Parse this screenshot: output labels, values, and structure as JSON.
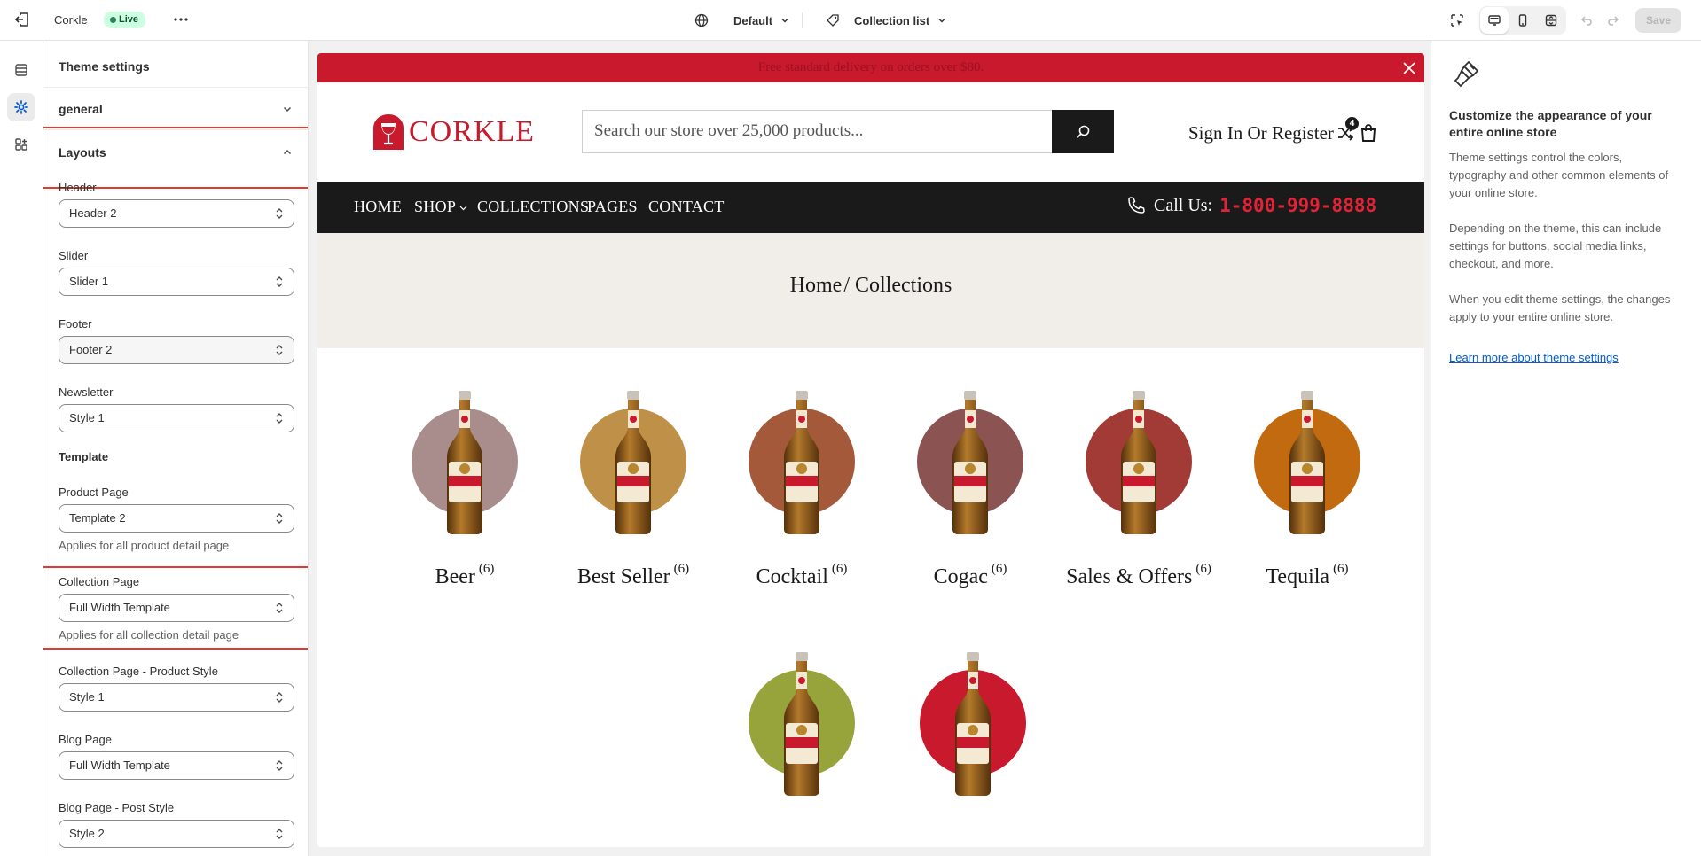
{
  "topbar": {
    "store_name": "Corkle",
    "status_badge": "Live",
    "theme_selector": "Default",
    "template_selector": "Collection list",
    "save_label": "Save"
  },
  "panel": {
    "title": "Theme settings",
    "sections": [
      {
        "label": "general",
        "expanded": false
      },
      {
        "label": "Layouts",
        "expanded": true
      }
    ],
    "fields": {
      "header": {
        "label": "Header",
        "value": "Header 2"
      },
      "slider": {
        "label": "Slider",
        "value": "Slider 1"
      },
      "footer": {
        "label": "Footer",
        "value": "Footer 2"
      },
      "newsletter": {
        "label": "Newsletter",
        "value": "Style 1"
      },
      "template_heading": "Template",
      "product_page": {
        "label": "Product Page",
        "value": "Template 2",
        "help": "Applies for all product detail page"
      },
      "collection_page": {
        "label": "Collection Page",
        "value": "Full Width Template",
        "help": "Applies for all collection detail page"
      },
      "collection_product_style": {
        "label": "Collection Page - Product Style",
        "value": "Style 1"
      },
      "blog_page": {
        "label": "Blog Page",
        "value": "Full Width Template"
      },
      "blog_post_style": {
        "label": "Blog Page - Post Style",
        "value": "Style 2"
      }
    }
  },
  "preview": {
    "announcement": "Free standard delivery on orders over $80.",
    "logo_text": "CORKLE",
    "search_placeholder": "Search our store over 25,000 products...",
    "account": {
      "sign_in": "Sign In",
      "or": "Or",
      "register": "Register"
    },
    "compare_count": "4",
    "nav": [
      "HOME",
      "SHOP",
      "COLLECTIONS",
      "PAGES",
      "CONTACT"
    ],
    "call_label": "Call Us:",
    "call_number": "1-800-999-8888",
    "breadcrumb": {
      "home": "Home",
      "sep": "/",
      "current": "Collections"
    },
    "collections": [
      {
        "name": "Beer",
        "count": "(6)",
        "color": "#a88d8c"
      },
      {
        "name": "Best Seller",
        "count": "(6)",
        "color": "#bf9048"
      },
      {
        "name": "Cocktail",
        "count": "(6)",
        "color": "#a3593a"
      },
      {
        "name": "Cogac",
        "count": "(6)",
        "color": "#8b5452"
      },
      {
        "name": "Sales & Offers",
        "count": "(6)",
        "color": "#a23a36"
      },
      {
        "name": "Tequila",
        "count": "(6)",
        "color": "#c26a10"
      },
      {
        "name": "",
        "count": "",
        "color": "#97a43b"
      },
      {
        "name": "",
        "count": "",
        "color": "#c8192d"
      }
    ]
  },
  "info": {
    "heading": "Customize the appearance of your entire online store",
    "p1": "Theme settings control the colors, typography and other common elements of your online store.",
    "p2": "Depending on the theme, this can include settings for buttons, social media links, checkout, and more.",
    "p3": "When you edit theme settings, the changes apply to your entire online store.",
    "link": "Learn more about theme settings"
  },
  "colors": {
    "accent_red": "#c8192d",
    "highlight_box": "#e03c31",
    "live_badge": "#cdfee1",
    "link_blue": "#005bd3"
  }
}
